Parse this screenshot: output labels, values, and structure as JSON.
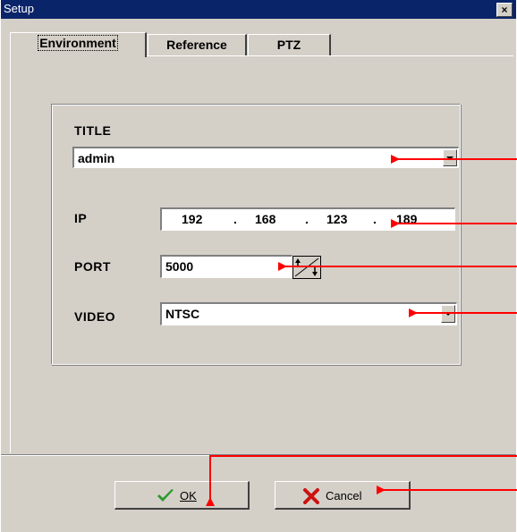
{
  "window": {
    "title": "Setup",
    "close_label": "×"
  },
  "tabs": [
    {
      "label": "Environment",
      "active": true
    },
    {
      "label": "Reference",
      "active": false
    },
    {
      "label": "PTZ",
      "active": false
    }
  ],
  "form": {
    "title_label": "TITLE",
    "title_value": "admin",
    "ip_label": "IP",
    "ip_octets": [
      "192",
      "168",
      "123",
      "189"
    ],
    "ip_separator": ".",
    "port_label": "PORT",
    "port_value": "5000",
    "video_label": "VIDEO",
    "video_value": "NTSC"
  },
  "buttons": {
    "ok_label": "OK",
    "cancel_label": "Cancel"
  },
  "colors": {
    "titlebar": "#0a246a",
    "face": "#d4d0c8",
    "annotation_arrow": "#ff0000",
    "ok_icon": "#2e9a2e",
    "cancel_icon": "#cc1111"
  },
  "icons": {
    "ok": "checkmark-icon",
    "cancel": "x-icon",
    "dropdown": "chevron-down-icon",
    "spin": "spin-updown-icon"
  }
}
